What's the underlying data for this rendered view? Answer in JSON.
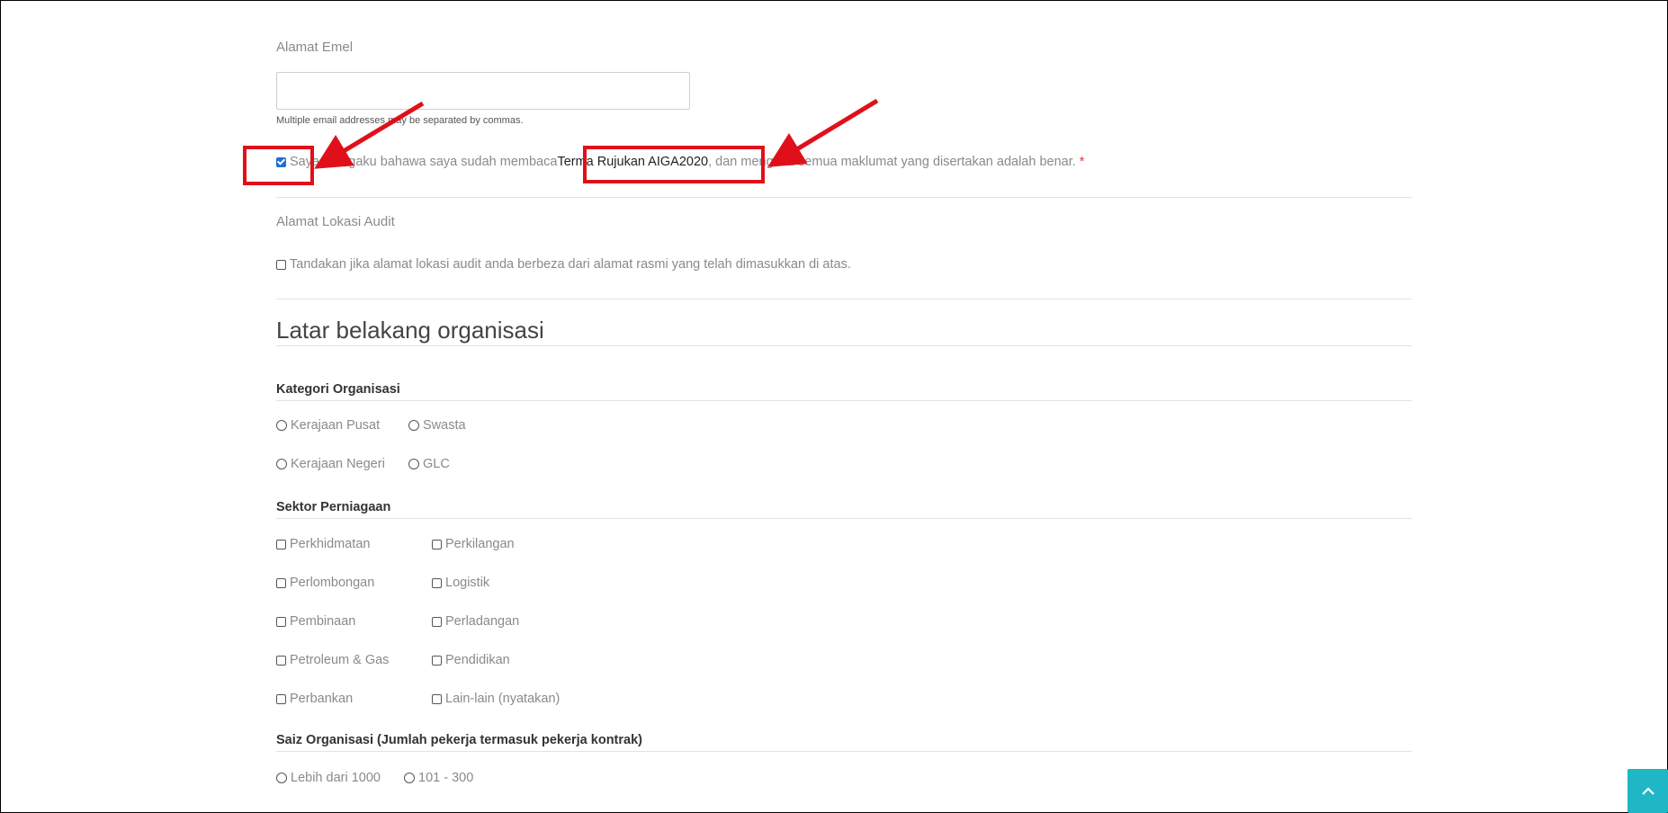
{
  "email": {
    "label": "Alamat Emel",
    "value": "",
    "help": "Multiple email addresses may be separated by commas."
  },
  "declaration": {
    "checked": true,
    "text_before": "Saya mengaku bahawa saya sudah membaca ",
    "link": "Terma Rujukan AIGA2020",
    "text_after": ", dan mengaku semua maklumat yang disertakan adalah benar.",
    "required_mark": "*"
  },
  "audit_location": {
    "label": "Alamat Lokasi Audit",
    "checkbox_label": "Tandakan jika alamat lokasi audit anda berbeza dari alamat rasmi yang telah dimasukkan di atas."
  },
  "background": {
    "title": "Latar belakang organisasi"
  },
  "category": {
    "label": "Kategori Organisasi",
    "options": [
      "Kerajaan Pusat",
      "Swasta",
      "Kerajaan Negeri",
      "GLC"
    ]
  },
  "sector": {
    "label": "Sektor Perniagaan",
    "options": [
      "Perkhidmatan",
      "Perkilangan",
      "Perlombongan",
      "Logistik",
      "Pembinaan",
      "Perladangan",
      "Petroleum & Gas",
      "Pendidikan",
      "Perbankan",
      "Lain-lain (nyatakan)"
    ]
  },
  "size": {
    "label": "Saiz Organisasi (Jumlah pekerja termasuk pekerja kontrak)",
    "options": [
      "Lebih dari 1000",
      "101 - 300"
    ]
  },
  "colors": {
    "annotation_red": "#e0101a",
    "scroll_button": "#1fb6c6",
    "checkbox_blue": "#1f6fd6"
  },
  "icons": {
    "scroll_top": "chevron-up-icon"
  }
}
